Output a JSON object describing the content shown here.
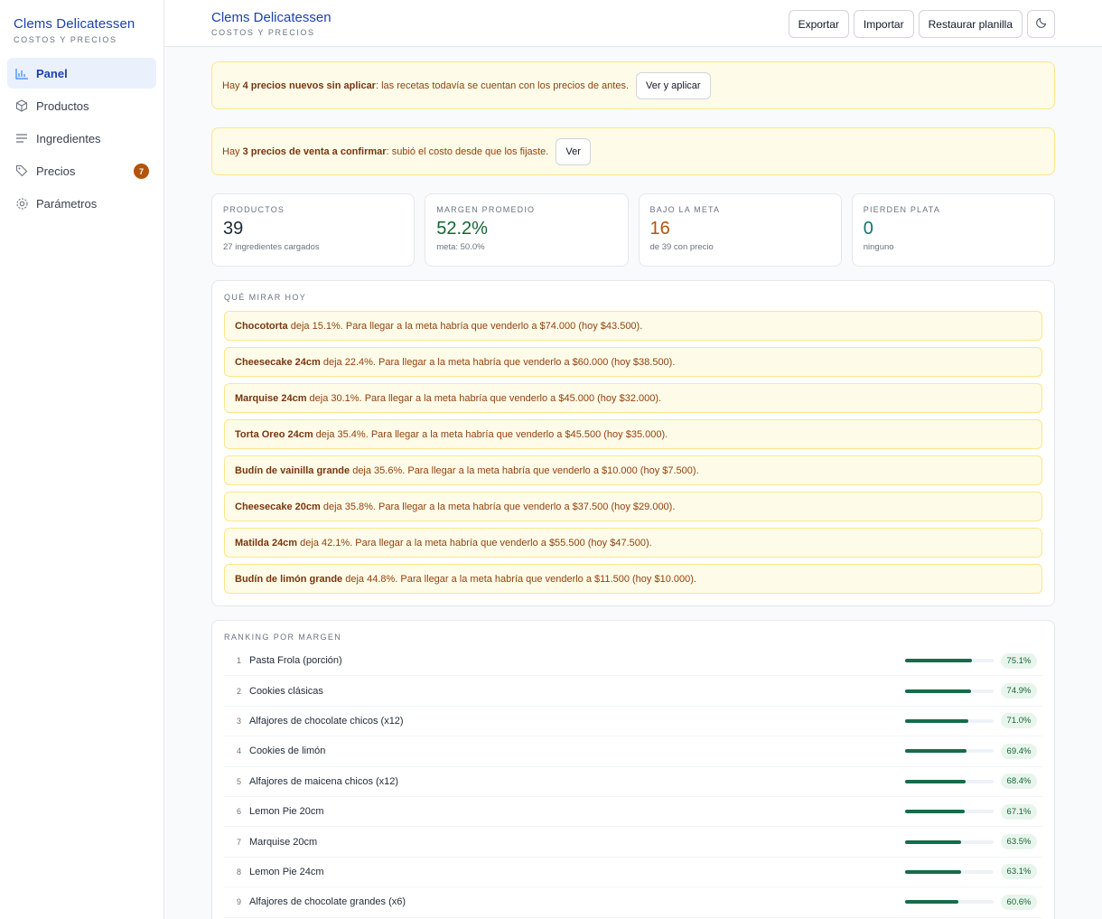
{
  "brand": {
    "name": "Clems Delicatessen",
    "subtitle": "COSTOS Y PRECIOS"
  },
  "sidebar": {
    "items": [
      {
        "label": "Panel",
        "icon": "chart-bar-icon",
        "active": true
      },
      {
        "label": "Productos",
        "icon": "box-icon"
      },
      {
        "label": "Ingredientes",
        "icon": "list-icon"
      },
      {
        "label": "Precios",
        "icon": "tag-icon",
        "badge": "7"
      },
      {
        "label": "Parámetros",
        "icon": "gear-icon"
      }
    ]
  },
  "header": {
    "title": "Clems Delicatessen",
    "subtitle": "COSTOS Y PRECIOS",
    "actions": {
      "export": "Exportar",
      "import": "Importar",
      "restore": "Restaurar planilla"
    },
    "theme_icon": "moon-icon"
  },
  "alerts": [
    {
      "pre": "Hay ",
      "bold": "4 precios nuevos sin aplicar",
      "post": ": las recetas todavía se cuentan con los precios de antes.",
      "button": "Ver y aplicar"
    },
    {
      "pre": "Hay ",
      "bold": "3 precios de venta a confirmar",
      "post": ": subió el costo desde que los fijaste.",
      "button": "Ver"
    }
  ],
  "stats": [
    {
      "label": "PRODUCTOS",
      "value": "39",
      "sub": "27 ingredientes cargados"
    },
    {
      "label": "MARGEN PROMEDIO",
      "value": "52.2%",
      "sub": "meta: 50.0%"
    },
    {
      "label": "BAJO LA META",
      "value": "16",
      "sub": "de 39 con precio"
    },
    {
      "label": "PIERDEN PLATA",
      "value": "0",
      "sub": "ninguno"
    }
  ],
  "watch": {
    "title": "QUÉ MIRAR HOY",
    "items": [
      {
        "product": "Chocotorta",
        "text": " deja 15.1%. Para llegar a la meta habría que venderlo a $74.000 (hoy $43.500)."
      },
      {
        "product": "Cheesecake 24cm",
        "text": " deja 22.4%. Para llegar a la meta habría que venderlo a $60.000 (hoy $38.500)."
      },
      {
        "product": "Marquise 24cm",
        "text": " deja 30.1%. Para llegar a la meta habría que venderlo a $45.000 (hoy $32.000)."
      },
      {
        "product": "Torta Oreo 24cm",
        "text": " deja 35.4%. Para llegar a la meta habría que venderlo a $45.500 (hoy $35.000)."
      },
      {
        "product": "Budín de vainilla grande",
        "text": " deja 35.6%. Para llegar a la meta habría que venderlo a $10.000 (hoy $7.500)."
      },
      {
        "product": "Cheesecake 20cm",
        "text": " deja 35.8%. Para llegar a la meta habría que venderlo a $37.500 (hoy $29.000)."
      },
      {
        "product": "Matilda 24cm",
        "text": " deja 42.1%. Para llegar a la meta habría que venderlo a $55.500 (hoy $47.500)."
      },
      {
        "product": "Budín de limón grande",
        "text": " deja 44.8%. Para llegar a la meta habría que venderlo a $11.500 (hoy $10.000)."
      }
    ]
  },
  "ranking": {
    "title": "RANKING POR MARGEN",
    "rows": [
      {
        "rank": "1",
        "name": "Pasta Frola (porción)",
        "pct": "75.1%",
        "value": 0.751
      },
      {
        "rank": "2",
        "name": "Cookies clásicas",
        "pct": "74.9%",
        "value": 0.749
      },
      {
        "rank": "3",
        "name": "Alfajores de chocolate chicos (x12)",
        "pct": "71.0%",
        "value": 0.71
      },
      {
        "rank": "4",
        "name": "Cookies de limón",
        "pct": "69.4%",
        "value": 0.694
      },
      {
        "rank": "5",
        "name": "Alfajores de maicena chicos (x12)",
        "pct": "68.4%",
        "value": 0.684
      },
      {
        "rank": "6",
        "name": "Lemon Pie 20cm",
        "pct": "67.1%",
        "value": 0.671
      },
      {
        "rank": "7",
        "name": "Marquise 20cm",
        "pct": "63.5%",
        "value": 0.635
      },
      {
        "rank": "8",
        "name": "Lemon Pie 24cm",
        "pct": "63.1%",
        "value": 0.631
      },
      {
        "rank": "9",
        "name": "Alfajores de chocolate grandes (x6)",
        "pct": "60.6%",
        "value": 0.606
      }
    ]
  },
  "colors": {
    "accent": "#1e40af",
    "warning_bg": "#fefce8",
    "warning_border": "#fde68a",
    "good": "#166534",
    "bad": "#b45309",
    "bar": "#166b4a"
  }
}
